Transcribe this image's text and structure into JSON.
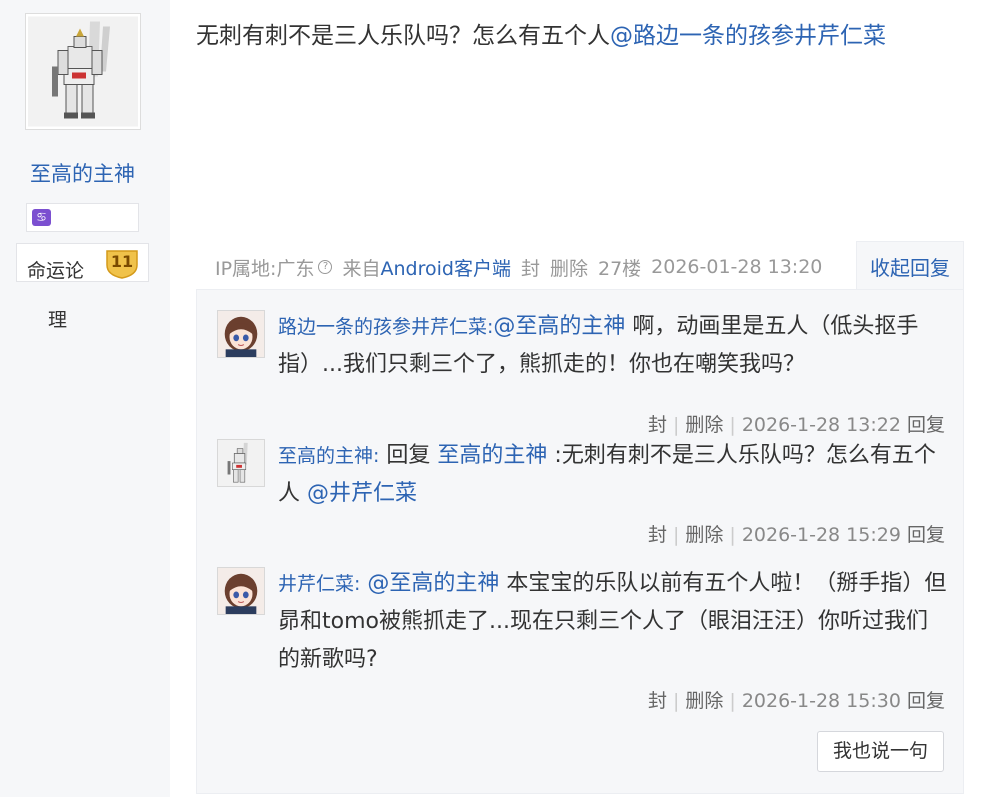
{
  "sidebar": {
    "username": "至高的主神",
    "sign_icon": "♋",
    "level_name": "命运论",
    "level_num": "11",
    "manage_label": "理"
  },
  "post": {
    "text": "无刺有刺不是三人乐队吗？怎么有五个人",
    "mention": "@路边一条的孩参井芹仁菜",
    "ip": "IP属地:广东",
    "source_prefix": "来自",
    "source": "Android客户端",
    "block_label": "封",
    "delete_label": "删除",
    "floor": "27楼",
    "time": "2026-01-28 13:20",
    "collapse_label": "收起回复"
  },
  "replies": [
    {
      "author": "路边一条的孩参井芹仁菜:",
      "mention": "@至高的主神",
      "text": " 啊，动画里是五人（低头抠手指）...我们只剩三个了，熊抓走的！你也在嘲笑我吗？",
      "prefix": "",
      "mention2": "",
      "text2": "",
      "block": "封",
      "delete": "删除",
      "time": "2026-1-28 13:22",
      "reply_label": "回复"
    },
    {
      "author": "至高的主神:",
      "prefix": " 回复 ",
      "mention": "至高的主神",
      "text": " :无刺有刺不是三人乐队吗？怎么有五个人 ",
      "mention2": "@井芹仁菜",
      "text2": "",
      "block": "封",
      "delete": "删除",
      "time": "2026-1-28 15:29",
      "reply_label": "回复"
    },
    {
      "author": "井芹仁菜:",
      "prefix": " ",
      "mention": "@至高的主神",
      "text": " 本宝宝的乐队以前有五个人啦！（掰手指）但昴和tomo被熊抓走了...现在只剩三个人了（眼泪汪汪）你听过我们的新歌吗?",
      "mention2": "",
      "text2": "",
      "block": "封",
      "delete": "删除",
      "time": "2026-1-28 15:30",
      "reply_label": "回复"
    }
  ],
  "say_button": "我也说一句",
  "icons": {
    "avatar_main": "robot-avatar-icon",
    "help": "question-circle-icon",
    "level": "level-badge-icon",
    "girl_avatar": "anime-girl-avatar-icon"
  },
  "colors": {
    "link": "#2d64b3",
    "meta": "#999999",
    "panel_bg": "#f6f7f9",
    "badge": "#f0c24a"
  }
}
